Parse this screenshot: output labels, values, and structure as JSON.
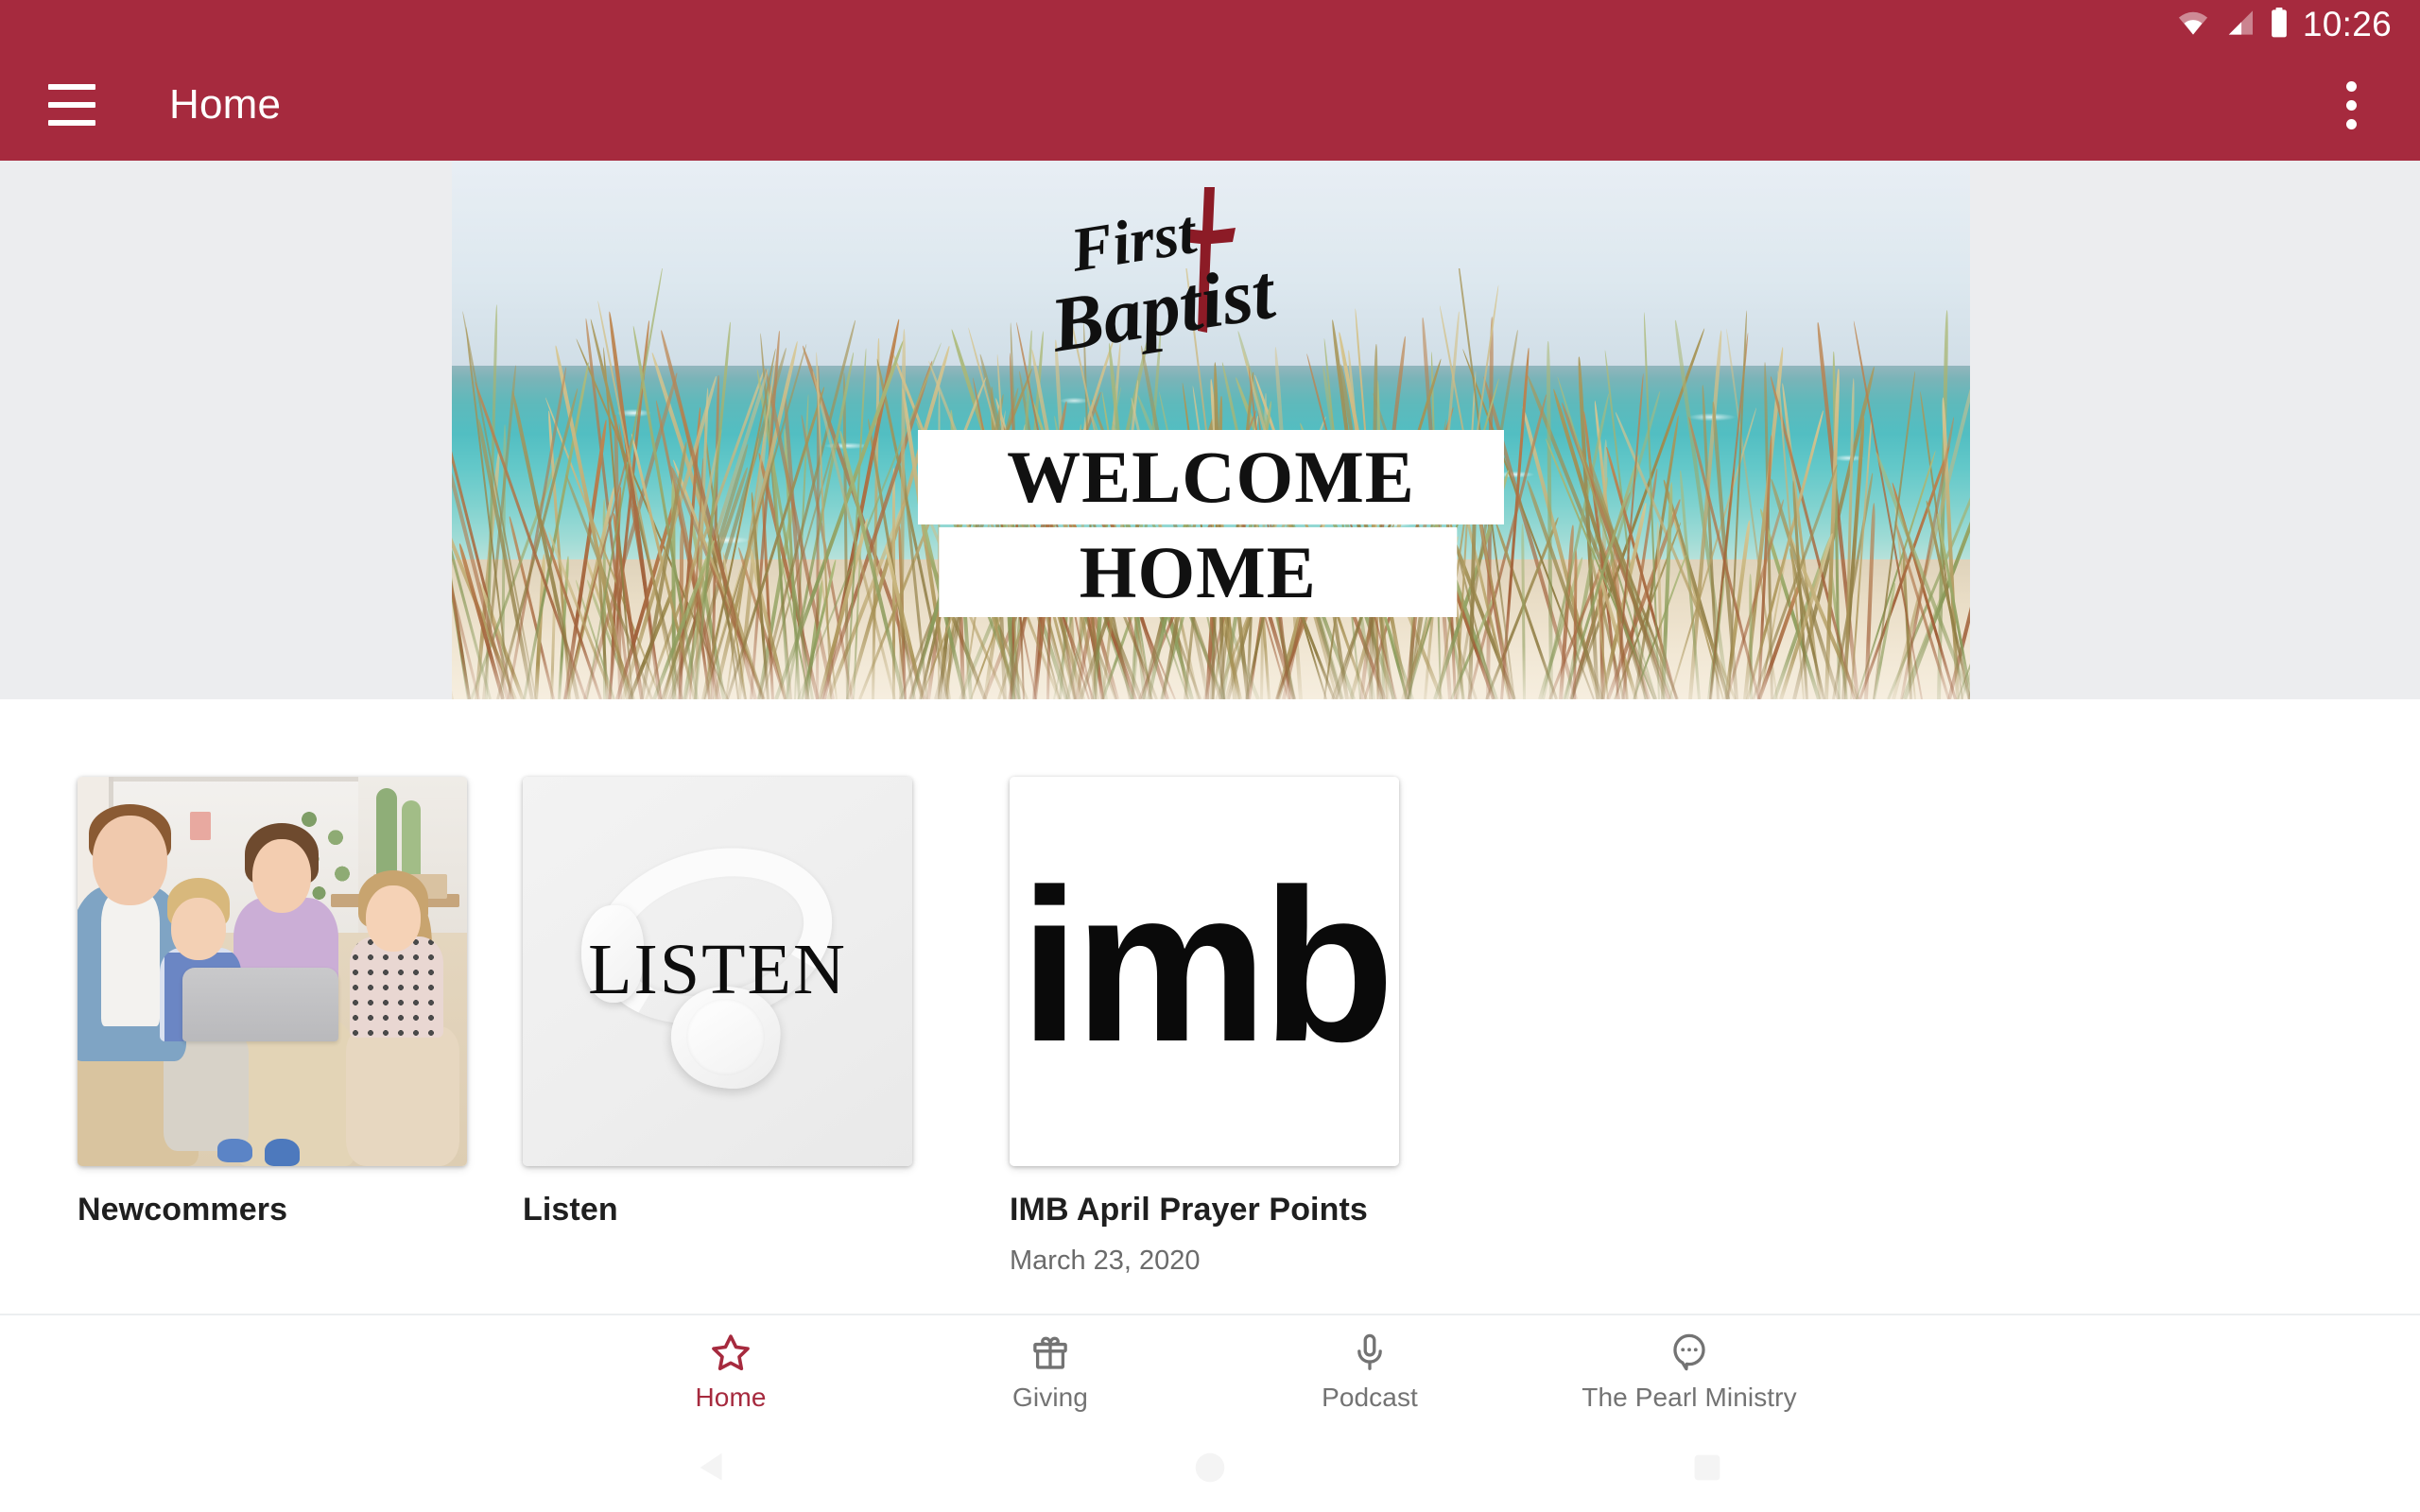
{
  "status_bar": {
    "time": "10:26",
    "icons": [
      "wifi-icon",
      "cellular-signal-icon",
      "battery-icon"
    ]
  },
  "app_bar": {
    "menu_icon": "hamburger-menu-icon",
    "title": "Home",
    "overflow_icon": "more-vertical-icon",
    "background_color": "#A62A3E"
  },
  "banner": {
    "logo_line1": "First",
    "logo_line2": "Baptist",
    "headline_line1": "WELCOME",
    "headline_line2": "HOME",
    "alt": "Beach dunes with sea grass and turquoise ocean"
  },
  "tiles": [
    {
      "title": "Newcommers",
      "date": "",
      "image_alt": "Family with laptop on a sofa"
    },
    {
      "title": "Listen",
      "date": "",
      "image_alt": "White headphones with the word LISTEN",
      "image_word": "LISTEN"
    },
    {
      "title": "IMB April Prayer Points",
      "date": "March 23, 2020",
      "image_alt": "imb logo",
      "image_word": "imb"
    }
  ],
  "bottom_nav": {
    "active_index": 0,
    "active_color": "#A62A3E",
    "inactive_color": "#737373",
    "items": [
      {
        "label": "Home",
        "icon": "star-outline-icon"
      },
      {
        "label": "Giving",
        "icon": "gift-icon"
      },
      {
        "label": "Podcast",
        "icon": "microphone-icon"
      },
      {
        "label": "The Pearl Ministry",
        "icon": "chat-bubble-dots-icon"
      }
    ]
  },
  "system_nav": {
    "items": [
      {
        "icon": "back-triangle-icon"
      },
      {
        "icon": "home-circle-icon"
      },
      {
        "icon": "recents-square-icon"
      }
    ]
  }
}
